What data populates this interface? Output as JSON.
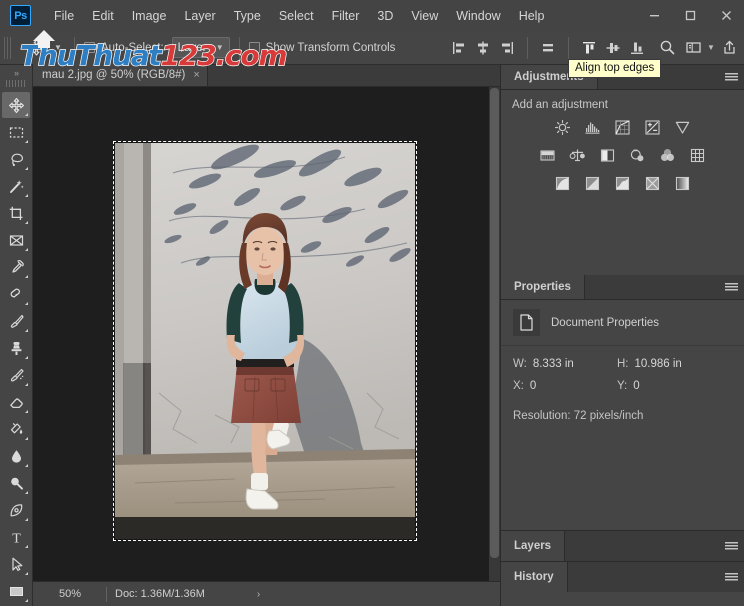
{
  "window": {
    "minimize_label": "minimize",
    "maximize_label": "maximize",
    "close_label": "close"
  },
  "menubar": {
    "logo": "Ps",
    "items": [
      {
        "label": "File"
      },
      {
        "label": "Edit"
      },
      {
        "label": "Image"
      },
      {
        "label": "Layer"
      },
      {
        "label": "Type"
      },
      {
        "label": "Select"
      },
      {
        "label": "Filter"
      },
      {
        "label": "3D"
      },
      {
        "label": "View"
      },
      {
        "label": "Window"
      },
      {
        "label": "Help"
      }
    ]
  },
  "options_bar": {
    "tool_icon": "move-tool-icon",
    "auto_select_label": "Auto-Select:",
    "auto_select_checked": false,
    "layer_select_value": "Layer",
    "show_transform_label": "Show Transform Controls",
    "show_transform_checked": false,
    "align_buttons": [
      {
        "name": "align-left-edges",
        "title": "Align left edges"
      },
      {
        "name": "align-horizontal-centers",
        "title": "Align horizontal centers"
      },
      {
        "name": "align-right-edges",
        "title": "Align right edges"
      },
      {
        "name": "distribute-horizontally",
        "title": "Distribute horizontally"
      },
      {
        "name": "align-top-edges",
        "title": "Align top edges"
      },
      {
        "name": "align-vertical-centers",
        "title": "Align vertical centers"
      },
      {
        "name": "align-bottom-edges",
        "title": "Align bottom edges"
      }
    ],
    "search_icon": "search-icon",
    "workspace_icon": "workspace-icon",
    "share_icon": "share-icon"
  },
  "tooltip": {
    "text": "Align top edges",
    "background": "#ffffcc"
  },
  "watermark": {
    "part1": "ThuThuat",
    "part2": "123.",
    "part3": "com",
    "blue": "#2e7ec4",
    "red": "#d83a3a"
  },
  "toolbar": {
    "collapse_label": "»",
    "tools": [
      {
        "name": "move-tool",
        "label": "Move Tool",
        "active": true
      },
      {
        "name": "rectangular-marquee-tool",
        "label": "Rectangular Marquee Tool",
        "active": false
      },
      {
        "name": "lasso-tool",
        "label": "Lasso Tool",
        "active": false
      },
      {
        "name": "magic-wand-tool",
        "label": "Quick Selection / Magic Wand Tool",
        "active": false
      },
      {
        "name": "crop-tool",
        "label": "Crop Tool",
        "active": false
      },
      {
        "name": "slice-tool",
        "label": "Frame Tool",
        "active": false
      },
      {
        "name": "eyedropper-tool",
        "label": "Eyedropper Tool",
        "active": false
      },
      {
        "name": "spot-healing-brush-tool",
        "label": "Spot Healing Brush Tool",
        "active": false
      },
      {
        "name": "brush-tool",
        "label": "Brush Tool",
        "active": false
      },
      {
        "name": "clone-stamp-tool",
        "label": "Clone Stamp Tool",
        "active": false
      },
      {
        "name": "history-brush-tool",
        "label": "History Brush Tool",
        "active": false
      },
      {
        "name": "eraser-tool",
        "label": "Eraser Tool",
        "active": false
      },
      {
        "name": "gradient-tool",
        "label": "Gradient Tool",
        "active": false
      },
      {
        "name": "blur-tool",
        "label": "Blur Tool",
        "active": false
      },
      {
        "name": "dodge-tool",
        "label": "Dodge Tool",
        "active": false
      },
      {
        "name": "pen-tool",
        "label": "Pen Tool",
        "active": false
      },
      {
        "name": "type-tool",
        "label": "Horizontal Type Tool",
        "active": false
      },
      {
        "name": "path-selection-tool",
        "label": "Path Selection Tool",
        "active": false
      },
      {
        "name": "rectangle-tool",
        "label": "Rectangle Tool",
        "active": false
      }
    ]
  },
  "document": {
    "tab_title": "mau 2.jpg @ 50% (RGB/8#)",
    "close_glyph": "×"
  },
  "status_bar": {
    "zoom": "50%",
    "doc_size": "Doc: 1.36M/1.36M",
    "arrow": "›"
  },
  "panels": {
    "adjustments": {
      "tab_label": "Adjustments",
      "add_label": "Add an adjustment",
      "rows": [
        [
          {
            "name": "brightness-contrast-icon",
            "label": "Brightness/Contrast"
          },
          {
            "name": "levels-icon",
            "label": "Levels"
          },
          {
            "name": "curves-icon",
            "label": "Curves"
          },
          {
            "name": "exposure-icon",
            "label": "Exposure"
          },
          {
            "name": "vibrance-icon",
            "label": "Vibrance"
          }
        ],
        [
          {
            "name": "hue-saturation-icon",
            "label": "Hue/Saturation"
          },
          {
            "name": "color-balance-icon",
            "label": "Color Balance"
          },
          {
            "name": "black-white-icon",
            "label": "Black & White"
          },
          {
            "name": "photo-filter-icon",
            "label": "Photo Filter"
          },
          {
            "name": "channel-mixer-icon",
            "label": "Channel Mixer"
          },
          {
            "name": "color-lookup-icon",
            "label": "Color Lookup"
          }
        ],
        [
          {
            "name": "invert-icon",
            "label": "Invert"
          },
          {
            "name": "posterize-icon",
            "label": "Posterize"
          },
          {
            "name": "threshold-icon",
            "label": "Threshold"
          },
          {
            "name": "selective-color-icon",
            "label": "Selective Color"
          },
          {
            "name": "gradient-map-icon",
            "label": "Gradient Map"
          }
        ]
      ]
    },
    "properties": {
      "tab_label": "Properties",
      "doc_icon": "document-icon",
      "doc_label": "Document Properties",
      "fields": [
        {
          "key": "W:",
          "value": "8.333 in"
        },
        {
          "key": "H:",
          "value": "10.986 in"
        },
        {
          "key": "X:",
          "value": "0"
        },
        {
          "key": "Y:",
          "value": "0"
        }
      ],
      "resolution": "Resolution: 72 pixels/inch"
    },
    "layers": {
      "tab_label": "Layers"
    },
    "history": {
      "tab_label": "History"
    }
  },
  "canvas": {
    "image_alt": "mau 2.jpg photograph of a woman standing against a concrete wall",
    "selection_active": true
  }
}
